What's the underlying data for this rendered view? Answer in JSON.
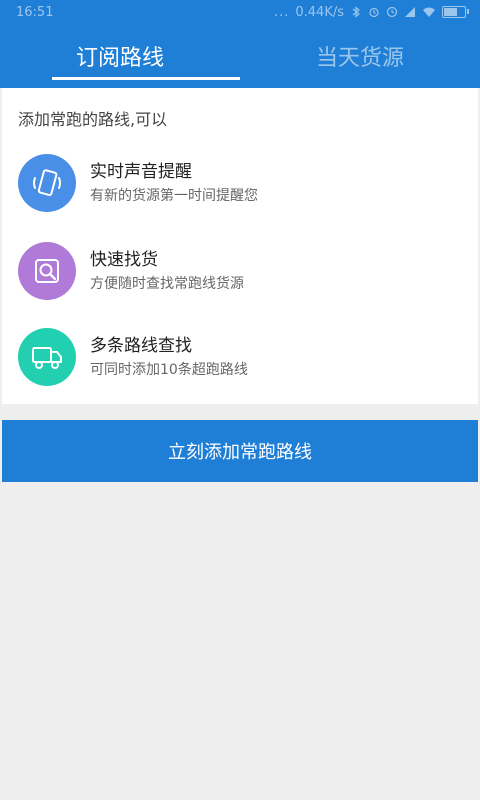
{
  "status_bar": {
    "time": "16:51",
    "dots": "...",
    "network_speed": "0.44K/s",
    "icons": [
      "bluetooth-icon",
      "alarm-icon",
      "clock-icon",
      "signal-icon",
      "wifi-icon",
      "battery-icon"
    ]
  },
  "tabs": [
    {
      "label": "订阅路线",
      "active": true
    },
    {
      "label": "当天货源",
      "active": false
    }
  ],
  "intro": "添加常跑的路线,可以",
  "features": [
    {
      "title": "实时声音提醒",
      "desc": "有新的货源第一时间提醒您",
      "icon": "phone-vibrate-icon",
      "color": "#4a8fe7"
    },
    {
      "title": "快速找货",
      "desc": "方便随时查找常跑线货源",
      "icon": "search-icon",
      "color": "#b07ad8"
    },
    {
      "title": "多条路线查找",
      "desc": "可同时添加10条超跑路线",
      "icon": "truck-icon",
      "color": "#22d0b1"
    }
  ],
  "cta_label": "立刻添加常跑路线",
  "colors": {
    "primary": "#1f7fd6",
    "background": "#efeeee"
  }
}
